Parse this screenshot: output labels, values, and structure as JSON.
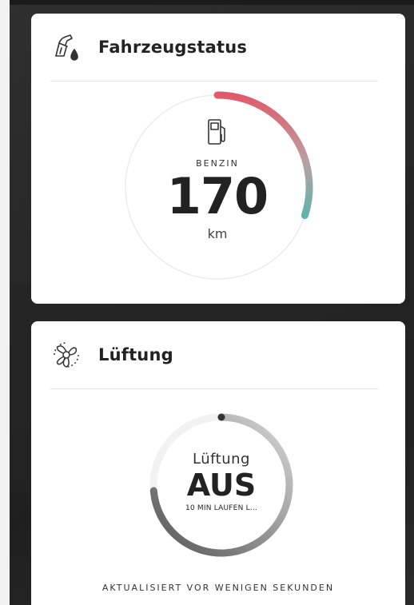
{
  "vehicle_status": {
    "title": "Fahrzeugstatus",
    "icon": "fuel-nozzle-drop-icon",
    "fuel_type": "BENZIN",
    "range_value": "170",
    "range_unit": "km",
    "gauge_level": 0.3,
    "gauge_colors": {
      "start": "#e05a6a",
      "end": "#5fb3aa"
    }
  },
  "ventilation": {
    "title": "Lüftung",
    "icon": "fan-icon",
    "label": "Lüftung",
    "state": "AUS",
    "sub_text": "10 MIN LAUFEN L...",
    "updated_text": "AKTUALISIERT VOR WENIGEN SEKUNDEN"
  }
}
